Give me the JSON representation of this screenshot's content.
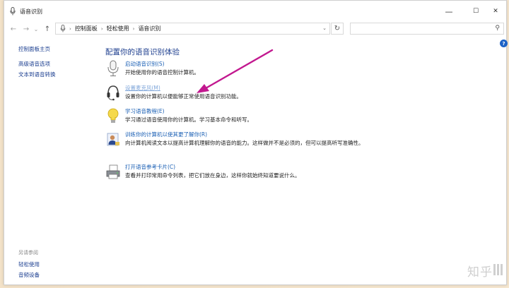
{
  "window": {
    "title": "语音识别"
  },
  "titlebar": {
    "minimize": "—",
    "maximize": "☐",
    "close": "✕"
  },
  "nav": {
    "back": "←",
    "forward": "→",
    "dropdown": "⌄",
    "up": "↑",
    "breadcrumbs": [
      "控制面板",
      "轻松使用",
      "语音识别"
    ],
    "addr_dropdown": "⌄",
    "refresh": "↻",
    "search_placeholder": ""
  },
  "left_pane": {
    "links": [
      "控制面板主页",
      "高级语音选项",
      "文本到语音转换"
    ],
    "see_also_heading": "另请参阅",
    "see_also": [
      "轻松使用",
      "音频设备"
    ]
  },
  "help": "?",
  "main": {
    "heading": "配置你的语音识别体验",
    "tasks": [
      {
        "link": "启动语音识别(S)",
        "desc": "开始使用你的语音控制计算机。"
      },
      {
        "link": "设置麦克风(M)",
        "desc": "设置你的计算机以便能够正常使用语音识别功能。"
      },
      {
        "link": "学习语音教程(E)",
        "desc": "学习通过语音使用你的计算机。学习基本命令和听写。"
      },
      {
        "link": "训练你的计算机以使其更了解你(R)",
        "desc": "向计算机阅读文本以提高计算机理解你的语音的能力。这样做并不是必须的，但可以提高听写准确性。"
      },
      {
        "link": "打开语音参考卡片(C)",
        "desc": "查看并打印常用命令列表，把它们放在身边，这样你就始终知道要说什么。"
      }
    ]
  },
  "watermark": "知乎",
  "colors": {
    "link": "#1a5fb4",
    "heading": "#1e3f8f",
    "arrow": "#c2188f"
  }
}
